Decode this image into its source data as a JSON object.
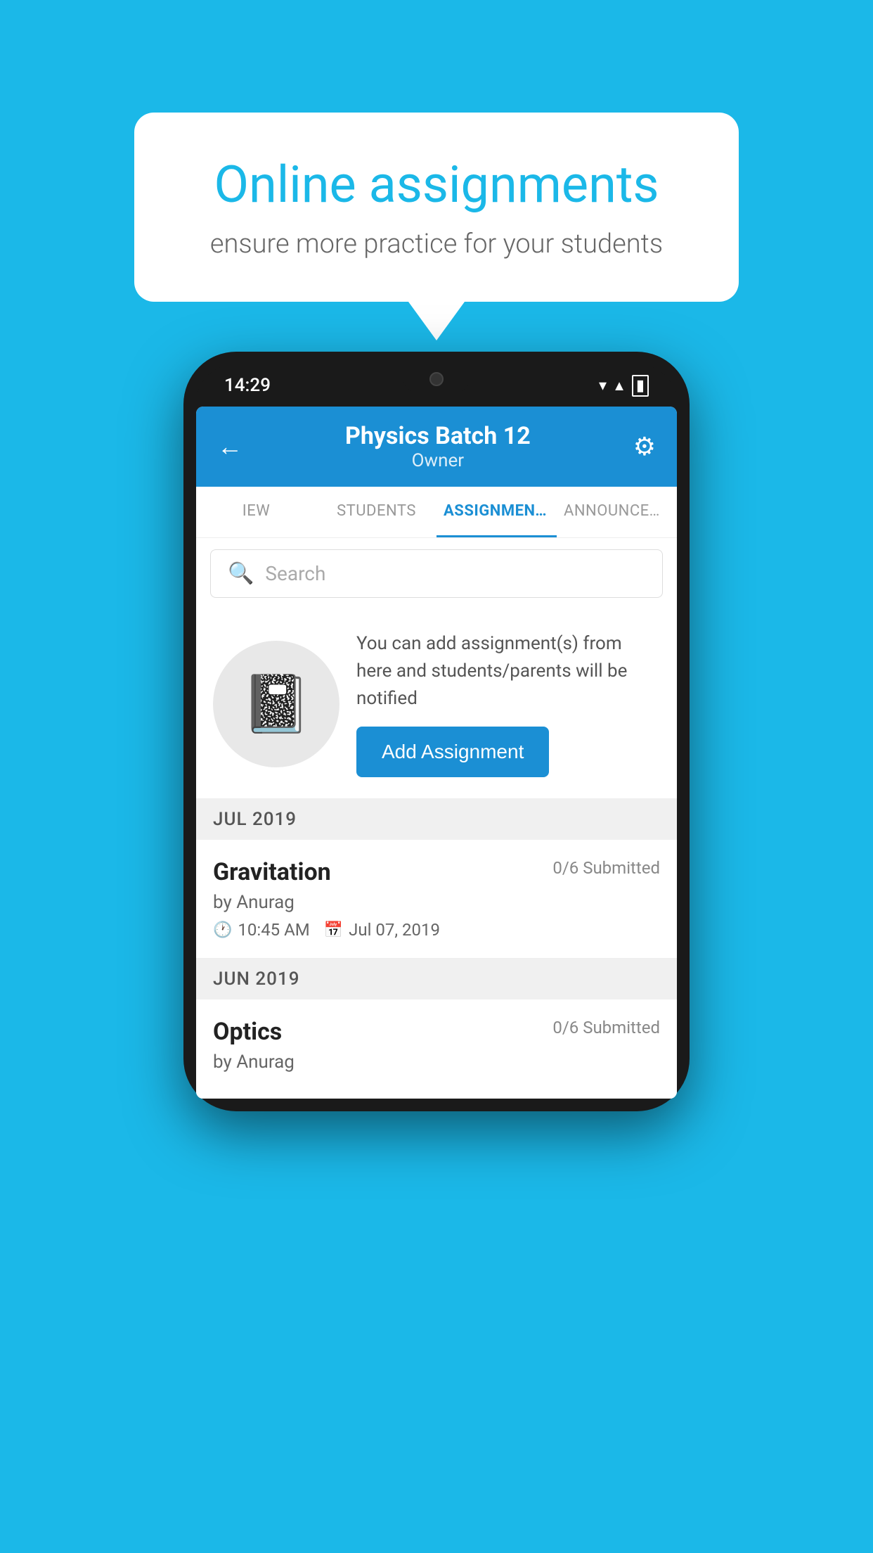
{
  "background": {
    "color": "#1BB8E8"
  },
  "speech_bubble": {
    "title": "Online assignments",
    "subtitle": "ensure more practice for your students"
  },
  "phone": {
    "status_bar": {
      "time": "14:29"
    },
    "header": {
      "title": "Physics Batch 12",
      "subtitle": "Owner",
      "back_label": "←",
      "gear_label": "⚙"
    },
    "tabs": [
      {
        "label": "IEW",
        "active": false
      },
      {
        "label": "STUDENTS",
        "active": false
      },
      {
        "label": "ASSIGNMENTS",
        "active": true
      },
      {
        "label": "ANNOUNCEMENTS",
        "active": false
      }
    ],
    "search": {
      "placeholder": "Search"
    },
    "promo": {
      "text": "You can add assignment(s) from here and students/parents will be notified",
      "button_label": "Add Assignment"
    },
    "sections": [
      {
        "label": "JUL 2019",
        "assignments": [
          {
            "name": "Gravitation",
            "submitted": "0/6 Submitted",
            "by": "by Anurag",
            "time": "10:45 AM",
            "date": "Jul 07, 2019"
          }
        ]
      },
      {
        "label": "JUN 2019",
        "assignments": [
          {
            "name": "Optics",
            "submitted": "0/6 Submitted",
            "by": "by Anurag",
            "time": "",
            "date": ""
          }
        ]
      }
    ]
  }
}
